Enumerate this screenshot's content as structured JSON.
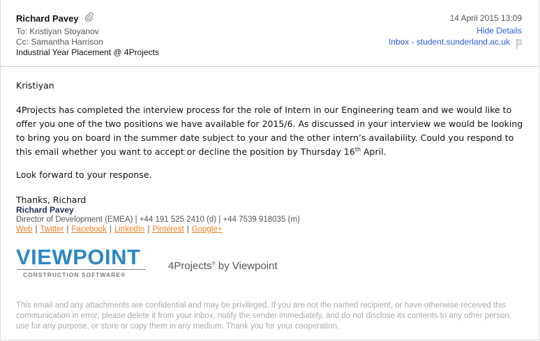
{
  "header": {
    "from": "Richard Pavey",
    "to_label": "To:",
    "to": "Kristiyan Stoyanov",
    "cc_label": "Cc:",
    "cc": "Samantha Harrison",
    "subject": "Industrial Year Placement @ 4Projects",
    "date": "14 April 2015 13:09",
    "hide_details": "Hide Details",
    "mailbox": "Inbox - student.sunderland.ac.uk",
    "attachment_icon": "paperclip-icon",
    "flag_icon": "flag-icon"
  },
  "body": {
    "greeting": "Kristiyan",
    "paragraph_main": "4Projects has completed the interview process for the role of Intern in our Engineering team and we would like to offer you one of the two positions we have available for 2015/6. As discussed in your interview we would be looking to bring you on board in the summer date subject to your and the other intern’s availability. Could you respond to this email whether you want to accept or decline the position by Thursday 16",
    "paragraph_sup": "th",
    "paragraph_end": " April.",
    "closing_line": "Look forward to your response.",
    "signoff": "Thanks, Richard"
  },
  "signature": {
    "name": "Richard Pavey",
    "title_line": "Director of Development (EMEA) | +44 191 525 2410 (d) | +44 7539 918035 (m)",
    "links": [
      "Web",
      "Twitter",
      "Facebook",
      "LinkedIn",
      "Pinterest",
      "Google+"
    ],
    "link_separator": "|",
    "logo_word": "VIEWPOINT",
    "logo_sub": "CONSTRUCTION SOFTWARE",
    "logo_sub_mark": "®",
    "brand_text_a": "4Projects",
    "brand_mark": "®",
    "brand_text_b": " by Viewpoint"
  },
  "disclaimer": "This email and any attachments are confidential and may be privileged. If you are not the named recipient, or have otherwise received this communication in error, please delete it from your inbox, notify the sender immediately, and do not disclose its contents to any other person, use for any purpose, or store or copy them in any medium. Thank you for your cooperation.",
  "colors": {
    "link_blue": "#2a5bd7",
    "link_orange": "#f07f1f",
    "logo_blue": "#2d89c4",
    "signature_navy": "#1f2f4f",
    "disclaimer_gray": "#aaaaaa"
  }
}
